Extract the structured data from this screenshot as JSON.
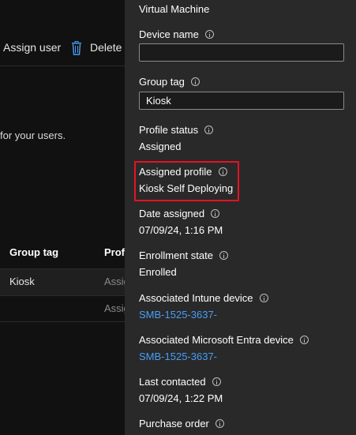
{
  "background": {
    "toolbar": {
      "assign_user_label": "Assign user",
      "delete_label": "Delete"
    },
    "description_text": "for your users.",
    "table": {
      "columns": [
        "Group tag",
        "Prof"
      ],
      "rows": [
        {
          "group_tag": "Kiosk",
          "profile": "Assig"
        },
        {
          "group_tag": "",
          "profile": "Assig"
        }
      ]
    }
  },
  "panel": {
    "model_value": "Virtual Machine",
    "device_name": {
      "label": "Device name",
      "value": ""
    },
    "group_tag": {
      "label": "Group tag",
      "value": "Kiosk"
    },
    "profile_status": {
      "label": "Profile status",
      "value": "Assigned"
    },
    "assigned_profile": {
      "label": "Assigned profile",
      "value": "Kiosk Self Deploying"
    },
    "date_assigned": {
      "label": "Date assigned",
      "value": "07/09/24, 1:16 PM"
    },
    "enrollment_state": {
      "label": "Enrollment state",
      "value": "Enrolled"
    },
    "intune_device": {
      "label": "Associated Intune device",
      "value": "SMB-1525-3637-"
    },
    "entra_device": {
      "label": "Associated Microsoft Entra device",
      "value": "SMB-1525-3637-"
    },
    "last_contacted": {
      "label": "Last contacted",
      "value": "07/09/24, 1:22 PM"
    },
    "purchase_order": {
      "label": "Purchase order"
    }
  },
  "colors": {
    "panel_bg": "#292929",
    "page_bg": "#111111",
    "link": "#479ef5",
    "highlight": "#e81123",
    "delete_icon": "#479ef5"
  },
  "icons": {
    "delete": "trash-icon",
    "info": "info-icon"
  }
}
